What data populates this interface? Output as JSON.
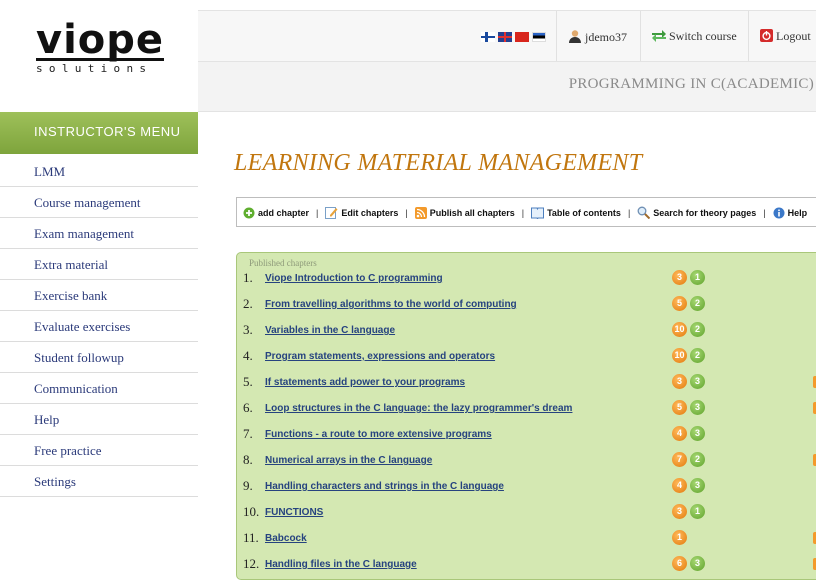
{
  "logo": {
    "word": "viope",
    "sub": "solutions"
  },
  "menu": {
    "header": "INSTRUCTOR'S MENU",
    "items": [
      "LMM",
      "Course management",
      "Exam management",
      "Extra material",
      "Exercise bank",
      "Evaluate exercises",
      "Student followup",
      "Communication",
      "Help",
      "Free practice",
      "Settings"
    ]
  },
  "topbar": {
    "user": "jdemo37",
    "switch_course": "Switch course",
    "logout": "Logout"
  },
  "course_title": "PROGRAMMING IN C(ACADEMIC)",
  "page_title": "LEARNING MATERIAL MANAGEMENT",
  "toolbar": {
    "add_chapter": "add chapter",
    "edit_chapters": "Edit chapters",
    "publish_all": "Publish all chapters",
    "toc": "Table of contents",
    "search": "Search for theory pages",
    "help": "Help",
    "separator": "|"
  },
  "chapters": {
    "label": "Published chapters",
    "rows": [
      {
        "num": "1.",
        "title": "Viope Introduction to C programming",
        "orange": "3",
        "green": "1",
        "rss": false
      },
      {
        "num": "2.",
        "title": "From travelling algorithms to the world of computing",
        "orange": "5",
        "green": "2",
        "rss": false
      },
      {
        "num": "3.",
        "title": "Variables in the C language",
        "orange": "10",
        "green": "2",
        "rss": false
      },
      {
        "num": "4.",
        "title": "Program statements, expressions and operators",
        "orange": "10",
        "green": "2",
        "rss": false
      },
      {
        "num": "5.",
        "title": "If statements add power to your programs",
        "orange": "3",
        "green": "3",
        "rss": true
      },
      {
        "num": "6.",
        "title": "Loop structures in the C language: the lazy programmer's dream",
        "orange": "5",
        "green": "3",
        "rss": true
      },
      {
        "num": "7.",
        "title": "Functions - a route to more extensive programs",
        "orange": "4",
        "green": "3",
        "rss": false
      },
      {
        "num": "8.",
        "title": "Numerical arrays in the C language",
        "orange": "7",
        "green": "2",
        "rss": true
      },
      {
        "num": "9.",
        "title": "Handling characters and strings in the C language",
        "orange": "4",
        "green": "3",
        "rss": false
      },
      {
        "num": "10.",
        "title": "FUNCTIONS",
        "orange": "3",
        "green": "1",
        "rss": false
      },
      {
        "num": "11.",
        "title": "Babcock",
        "orange": "1",
        "green": null,
        "rss": true
      },
      {
        "num": "12.",
        "title": "Handling files in the C language",
        "orange": "6",
        "green": "3",
        "rss": true
      }
    ]
  },
  "colors": {
    "accent_green": "#8ab14a",
    "title_orange": "#c1760e",
    "link_blue": "#26437f",
    "panel_green": "#d4e8b2"
  }
}
